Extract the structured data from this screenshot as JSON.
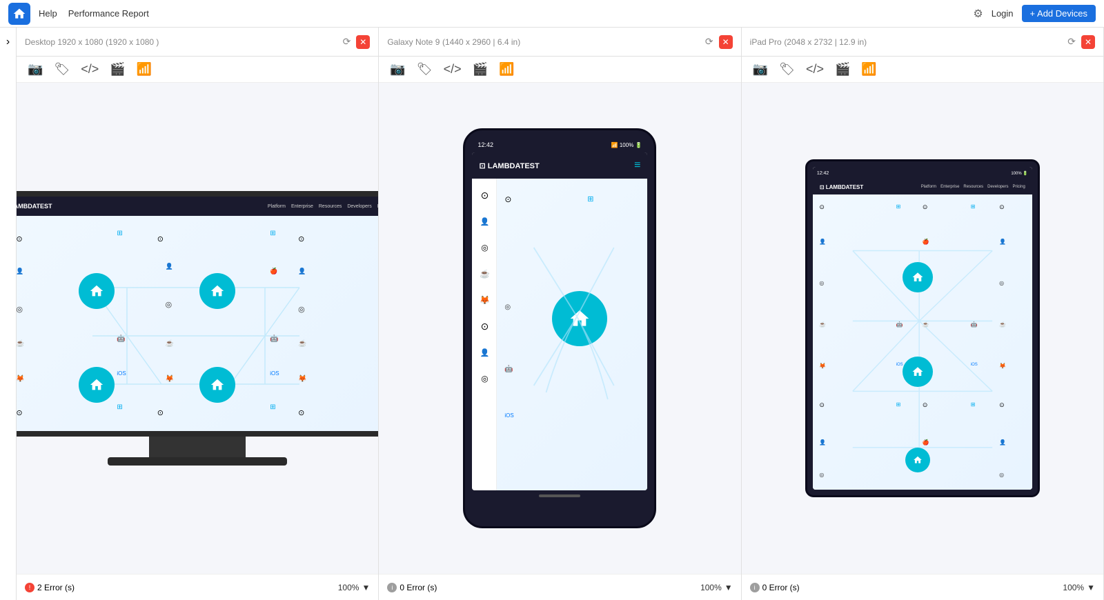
{
  "topnav": {
    "help": "Help",
    "report": "Performance Report",
    "login": "Login",
    "add_devices": "+ Add Devices"
  },
  "panels": [
    {
      "id": "desktop",
      "title": "Desktop 1920 x 1080",
      "subtitle": "(1920 x 1080 )",
      "type": "desktop",
      "error_count": "2 Error (s)",
      "error_type": "red",
      "zoom": "100%"
    },
    {
      "id": "galaxy",
      "title": "Galaxy Note 9",
      "subtitle": "(1440 x 2960 | 6.4 in)",
      "type": "phone",
      "error_count": "0 Error (s)",
      "error_type": "gray",
      "zoom": "100%"
    },
    {
      "id": "ipad",
      "title": "iPad Pro",
      "subtitle": "(2048 x 2732 | 12.9 in)",
      "type": "tablet",
      "error_count": "0 Error (s)",
      "error_type": "gray",
      "zoom": "100%"
    }
  ],
  "website": {
    "url": "lambdatest.com",
    "nav_items": [
      "Platform",
      "Enterprise",
      "Resources",
      "Developers",
      "Pricing"
    ]
  },
  "sidebar_toggle": "›",
  "phone_status": {
    "time": "12:42",
    "battery": "100%"
  }
}
